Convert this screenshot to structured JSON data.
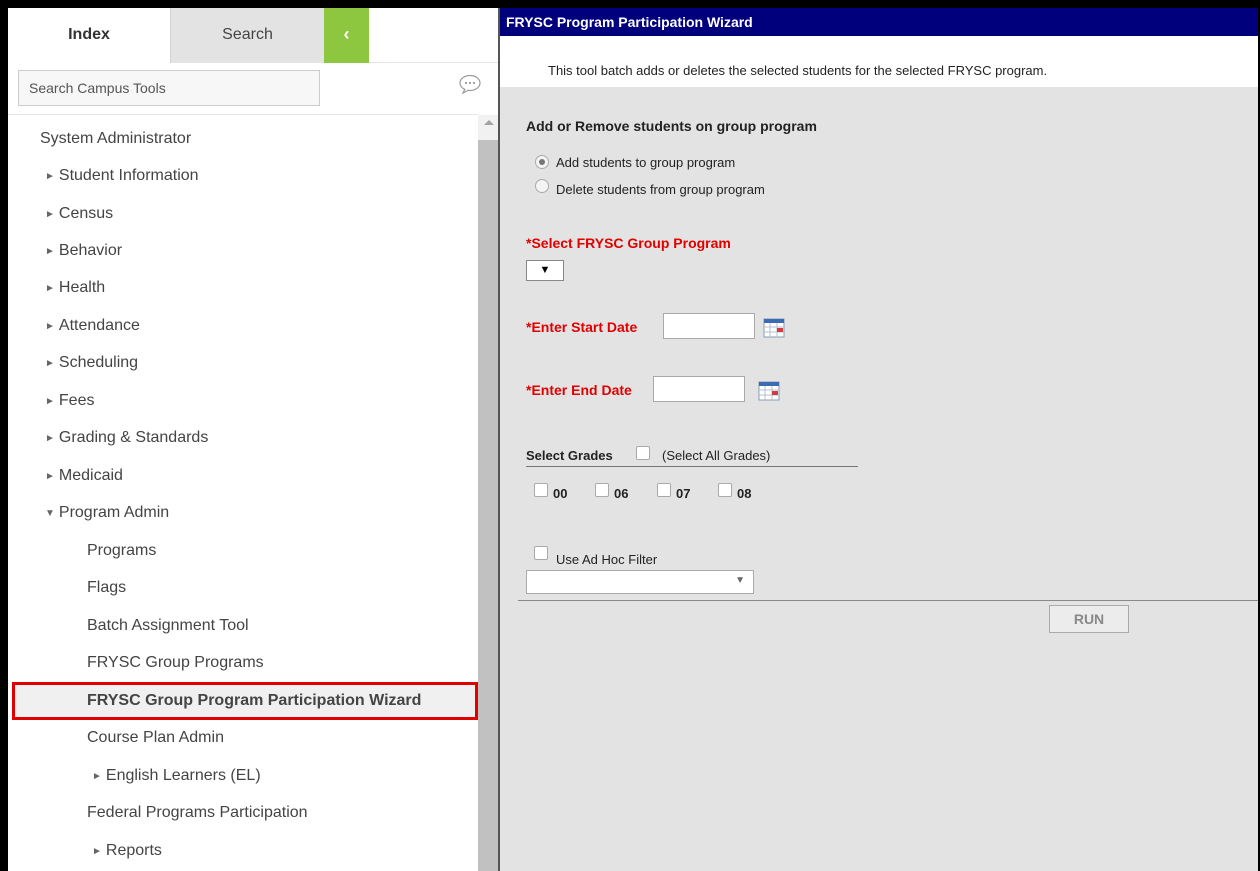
{
  "sidebar": {
    "tabs": {
      "index": "Index",
      "search": "Search",
      "collapse": "‹"
    },
    "search_placeholder": "Search Campus Tools",
    "items": [
      {
        "label": "System Administrator"
      },
      {
        "label": "Student Information",
        "arrow": "►"
      },
      {
        "label": "Census",
        "arrow": "►"
      },
      {
        "label": "Behavior",
        "arrow": "►"
      },
      {
        "label": "Health",
        "arrow": "►"
      },
      {
        "label": "Attendance",
        "arrow": "►"
      },
      {
        "label": "Scheduling",
        "arrow": "►"
      },
      {
        "label": "Fees",
        "arrow": "►"
      },
      {
        "label": "Grading & Standards",
        "arrow": "►"
      },
      {
        "label": "Medicaid",
        "arrow": "►"
      },
      {
        "label": "Program Admin",
        "arrow": "▼"
      },
      {
        "label": "Programs"
      },
      {
        "label": "Flags"
      },
      {
        "label": "Batch Assignment Tool"
      },
      {
        "label": "FRYSC Group Programs"
      },
      {
        "label": "FRYSC Group Program Participation Wizard"
      },
      {
        "label": "Course Plan Admin"
      },
      {
        "label": "English Learners (EL)",
        "arrow": "►"
      },
      {
        "label": "Federal Programs Participation"
      },
      {
        "label": "Reports",
        "arrow": "►"
      }
    ]
  },
  "main": {
    "title": "FRYSC Program Participation Wizard",
    "description": "This tool batch adds or deletes the selected students for the selected FRYSC program.",
    "mode_heading": "Add or Remove students on group program",
    "mode_options": [
      {
        "label": "Add students to group program",
        "checked": true
      },
      {
        "label": "Delete students from group program",
        "checked": false
      }
    ],
    "group_program_label": "*Select FRYSC Group Program",
    "group_program_value": "▼",
    "start_date_label": "*Enter Start Date",
    "start_date_value": "",
    "end_date_label": "*Enter End Date",
    "end_date_value": "",
    "grades_label": "Select Grades",
    "select_all_grades_label": "(Select All Grades)",
    "grades": [
      "00",
      "06",
      "07",
      "08"
    ],
    "adhoc_label": "Use Ad Hoc Filter",
    "adhoc_arrow": "▼",
    "run_label": "RUN"
  },
  "colors": {
    "title_bar": "#00007d",
    "collapse_button": "#8dc63f",
    "required_label": "#e00000",
    "selected_outline": "#e00000"
  },
  "icons": {
    "chat": "speech-bubble-icon",
    "calendar": "calendar-icon"
  }
}
